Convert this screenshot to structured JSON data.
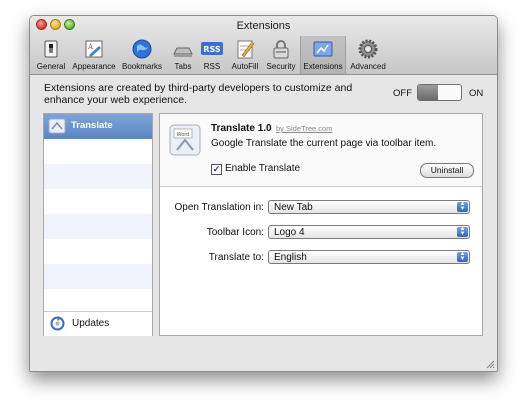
{
  "window": {
    "title": "Extensions"
  },
  "toolbar": {
    "items": [
      {
        "label": "General",
        "icon": "general-switch-icon"
      },
      {
        "label": "Appearance",
        "icon": "appearance-icon"
      },
      {
        "label": "Bookmarks",
        "icon": "globe-icon"
      },
      {
        "label": "Tabs",
        "icon": "tabs-icon"
      },
      {
        "label": "RSS",
        "icon": "rss-icon"
      },
      {
        "label": "AutoFill",
        "icon": "autofill-pencil-icon"
      },
      {
        "label": "Security",
        "icon": "lock-icon"
      },
      {
        "label": "Extensions",
        "icon": "extensions-icon",
        "active": true
      },
      {
        "label": "Advanced",
        "icon": "gear-icon"
      }
    ],
    "rss_badge": "RSS"
  },
  "intro": {
    "text": "Extensions are created by third-party developers to customize and enhance your web experience."
  },
  "switch": {
    "off_label": "OFF",
    "on_label": "ON",
    "state": "off"
  },
  "sidebar": {
    "items": [
      {
        "label": "Translate",
        "selected": true
      }
    ],
    "updates_label": "Updates"
  },
  "extension": {
    "name": "Translate",
    "version": "1.0",
    "author": "by SideTree.com",
    "description": "Google Translate the current page via toolbar item.",
    "enable_label": "Enable Translate",
    "enabled": true,
    "uninstall_label": "Uninstall",
    "icon_text": "Word"
  },
  "prefs": [
    {
      "label": "Open Translation in:",
      "value": "New Tab"
    },
    {
      "label": "Toolbar Icon:",
      "value": "Logo 4"
    },
    {
      "label": "Translate to:",
      "value": "English"
    }
  ],
  "colors": {
    "selection": "#5b86c3",
    "popup_arrow": "#2f66c2"
  }
}
